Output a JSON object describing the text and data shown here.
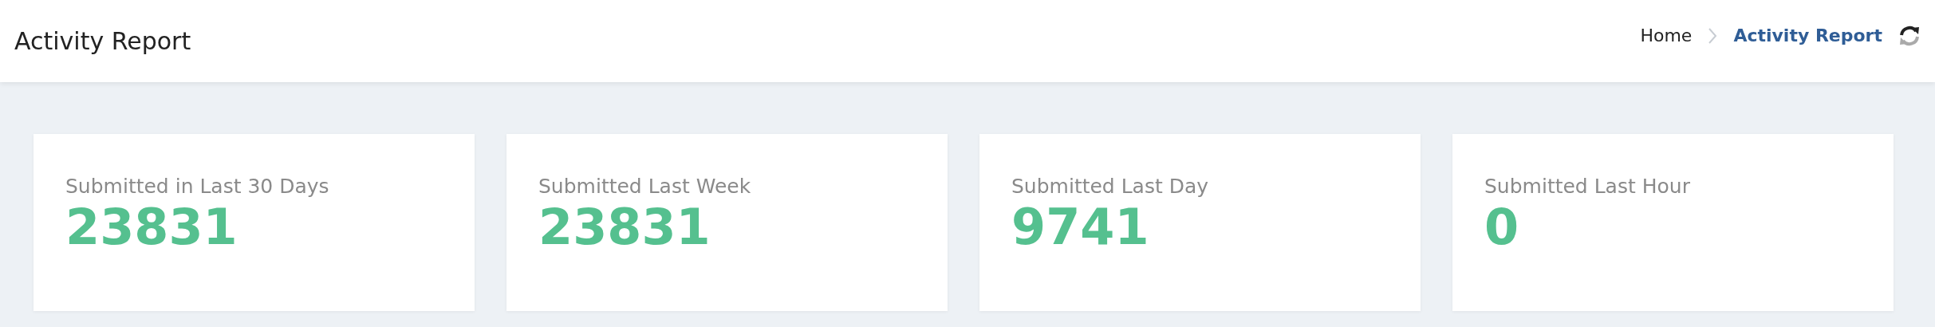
{
  "header": {
    "title": "Activity Report",
    "breadcrumb": [
      {
        "label": "Home",
        "selected": false
      },
      {
        "label": "Activity Report",
        "selected": true
      }
    ]
  },
  "stats": [
    {
      "label": "Submitted in Last 30 Days",
      "value": "23831"
    },
    {
      "label": "Submitted Last Week",
      "value": "23831"
    },
    {
      "label": "Submitted Last Day",
      "value": "9741"
    },
    {
      "label": "Submitted Last Hour",
      "value": "0"
    }
  ]
}
